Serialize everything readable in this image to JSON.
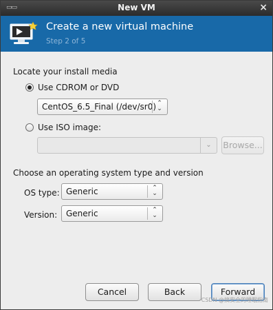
{
  "window": {
    "title": "New VM",
    "close_icon": "close-icon",
    "menu_icon": "window-menu-icon"
  },
  "header": {
    "title": "Create a new virtual machine",
    "step": "Step 2 of 5",
    "icon": "new-vm-monitor-icon",
    "background": "#1869a8"
  },
  "install_media": {
    "section_label": "Locate your install media",
    "cdrom": {
      "label": "Use CDROM or DVD",
      "selected": true,
      "device_value": "CentOS_6.5_Final (/dev/sr0)"
    },
    "iso": {
      "label": "Use ISO image:",
      "selected": false,
      "path_value": "",
      "browse_label": "Browse..."
    }
  },
  "os_section": {
    "section_label": "Choose an operating system type and version",
    "os_type_label": "OS type:",
    "os_type_value": "Generic",
    "version_label": "Version:",
    "version_value": "Generic"
  },
  "buttons": {
    "cancel": "Cancel",
    "back": "Back",
    "forward": "Forward"
  },
  "watermark": "CSDN @搞安全的睡眠指南"
}
